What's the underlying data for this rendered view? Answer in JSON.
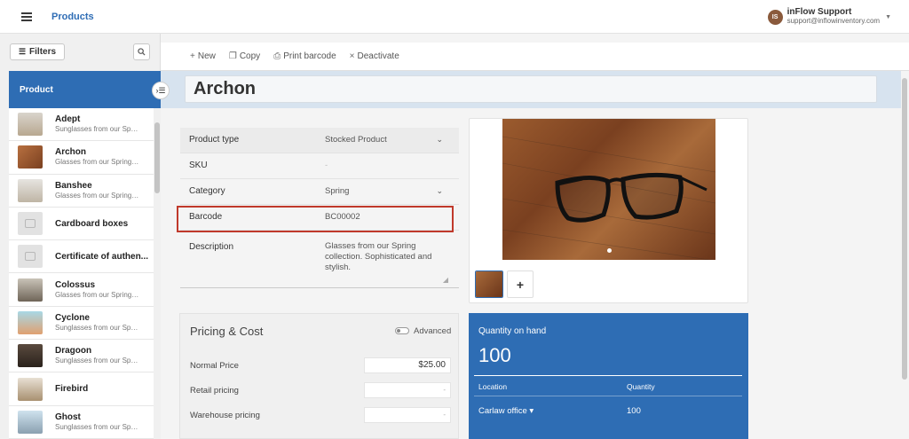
{
  "header": {
    "title": "Products",
    "user": {
      "initials": "IS",
      "name": "inFlow Support",
      "email": "support@inflowinventory.com"
    }
  },
  "sidebar": {
    "filters_label": "Filters",
    "list_header": "Product",
    "items": [
      {
        "name": "Adept",
        "sub": "Sunglasses from our Spring Collection",
        "thumb": "photo"
      },
      {
        "name": "Archon",
        "sub": "Glasses from our Spring collection",
        "thumb": "photo"
      },
      {
        "name": "Banshee",
        "sub": "Glasses from our Spring Collection",
        "thumb": "photo"
      },
      {
        "name": "Cardboard boxes",
        "sub": "",
        "thumb": "placeholder"
      },
      {
        "name": "Certificate of authen...",
        "sub": "",
        "thumb": "placeholder"
      },
      {
        "name": "Colossus",
        "sub": "Glasses from our Spring Collection",
        "thumb": "photo"
      },
      {
        "name": "Cyclone",
        "sub": "Sunglasses from our Spring Collection",
        "thumb": "photo"
      },
      {
        "name": "Dragoon",
        "sub": "Sunglasses from our Spring Collection",
        "thumb": "photo"
      },
      {
        "name": "Firebird",
        "sub": "",
        "thumb": "photo"
      },
      {
        "name": "Ghost",
        "sub": "Sunglasses from our Spring Collection",
        "thumb": "photo"
      }
    ]
  },
  "toolbar": {
    "new_label": "New",
    "copy_label": "Copy",
    "print_label": "Print barcode",
    "deactivate_label": "Deactivate"
  },
  "product": {
    "name": "Archon",
    "fields": {
      "type_label": "Product type",
      "type_value": "Stocked Product",
      "sku_label": "SKU",
      "sku_value": "-",
      "category_label": "Category",
      "category_value": "Spring",
      "barcode_label": "Barcode",
      "barcode_value": "BC00002",
      "description_label": "Description",
      "description_value": "Glasses from our Spring collection. Sophisticated and stylish."
    }
  },
  "pricing": {
    "title": "Pricing & Cost",
    "advanced_label": "Advanced",
    "rows": [
      {
        "label": "Normal Price",
        "value": "$25.00"
      },
      {
        "label": "Retail pricing",
        "value": "-"
      },
      {
        "label": "Warehouse pricing",
        "value": "-"
      }
    ]
  },
  "quantity": {
    "title": "Quantity on hand",
    "total": "100",
    "col_location": "Location",
    "col_quantity": "Quantity",
    "rows": [
      {
        "location": "Carlaw office ▾",
        "quantity": "100"
      }
    ]
  },
  "colors": {
    "accent": "#2e6db4",
    "highlight": "#c0392b"
  }
}
